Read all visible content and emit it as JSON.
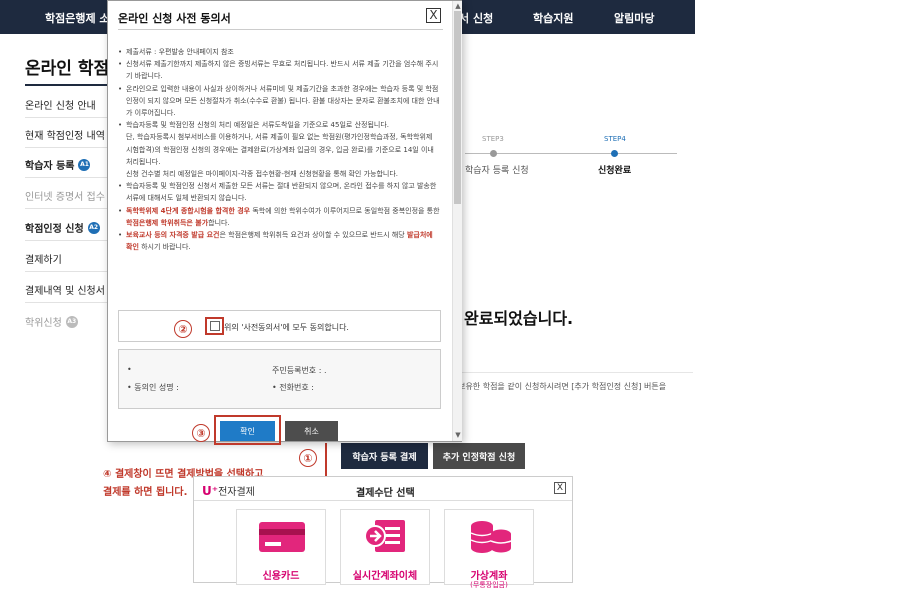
{
  "topnav": {
    "items": [
      "학점은행제 소",
      "서 신청",
      "학습지원",
      "알림마당"
    ]
  },
  "page": {
    "title": "온라인 학점인"
  },
  "sidebar": {
    "items": [
      {
        "label": "온라인 신청 안내",
        "badge": ""
      },
      {
        "label": "현재 학점인정 내역",
        "badge": ""
      },
      {
        "label": "학습자 등록",
        "badge": "A1"
      },
      {
        "label": "인터넷 증명서 접수",
        "badge": ""
      },
      {
        "label": "학점인정 신청",
        "badge": "A2"
      },
      {
        "label": "결제하기",
        "badge": ""
      },
      {
        "label": "결제내역 및 신청서 출",
        "badge": ""
      },
      {
        "label": "학위신청",
        "badge": "A3"
      }
    ]
  },
  "steps": [
    {
      "label": "STEP3",
      "name": "학습자 등록 신청"
    },
    {
      "label": "STEP4",
      "name": "신청완료"
    }
  ],
  "main": {
    "complete_message": "완료되었습니다.",
    "info_line": ", 보유한 학점을 같이 신청하시려면 [추가 학점인정 신청] 버튼을",
    "register_button": "학습자 등록 결제",
    "add_button": "추가 인정학점 신청"
  },
  "annotations": {
    "num1": "①",
    "num2": "②",
    "num3": "③",
    "step4_line1": "④ 결제창이 뜨면 결제방법을 선택하고",
    "step4_line2": "결제를 하면 됩니다."
  },
  "payment": {
    "logo_mark": "U⁺",
    "logo_text": "전자결제",
    "title": "결제수단 선택",
    "close": "X",
    "options": [
      {
        "label": "신용카드",
        "sub": ""
      },
      {
        "label": "실시간계좌이체",
        "sub": ""
      },
      {
        "label": "가상계좌",
        "sub": "(무통장입금)"
      }
    ]
  },
  "modal": {
    "title": "온라인 신청 사전 동의서",
    "close": "X",
    "terms": [
      {
        "type": "bullet",
        "text": "제출서류 : 우편발송 안내페이지 참조"
      },
      {
        "type": "bullet",
        "text": "신청서류 제출기한까지 제출하지 않은 증빙서류는 무효로 처리됩니다. 반드시 서류 제출 기간을 엄수해 주시기 바랍니다."
      },
      {
        "type": "bullet",
        "text": "온라인으로 입력한 내용이 사실과 상이하거나 서류미비 및 제출기간을 초과한 경우에는 학습자 등록 및 학점인정이 되지 않으며 모든 신청절차가 취소(수수료 환불) 됩니다. 환불 대상자는 문자로 환불조치에 대한 안내가 이루어집니다."
      },
      {
        "type": "bullet",
        "text": "학습자등록 및 학점인정 신청의 처리 예정일은 서류도착일을 기준으로 45일로 산정됩니다."
      },
      {
        "type": "indent",
        "text": "단, 학습자등록시 첨부서비스를 이용하거나, 서류 제출이 필요 없는 학점원(평가인정학습과정, 독학학위제 시험합격)의 학점인정 신청의 경우에는 결제완료(가상계좌 입금의 경우, 입금 완료)를 기준으로 14일 이내 처리됩니다."
      },
      {
        "type": "indent",
        "text": "신청 건수별 처리 예정일은 마이페이지-각종 접수현황-현재 신청현황을 통해 확인 가능합니다."
      },
      {
        "type": "bullet",
        "text": "학습자등록 및 학점인정 신청서 제출한 모든 서류는 절대 반환되지 않으며, 온라인 접수를 하지 않고 발송한 서류에 대해서도 일체 반환되지 않습니다."
      },
      {
        "type": "bullet-red",
        "hl1": "독학학위제 4단계 종합시험을 합격한 경우",
        "text": " 독학에 의한 학위수여가 이루어지므로 동일학점 중복인정을 통한 ",
        "hl2": "학점은행제 학위취득은 불가",
        "tail": "합니다."
      },
      {
        "type": "bullet-red2",
        "hl1": "보육교사 등의 자격증 발급 요건",
        "text": "은 학점은행제 학위취득 요건과 상이할 수 있으므로 반드시 해당 ",
        "hl2": "발급처에 확인",
        "tail": " 하시기 바랍니다."
      }
    ],
    "agree_label": "위의 '사전동의서'에 모두 동의합니다.",
    "person": {
      "row1_right": "주민등록번호 : .",
      "row2_left": "동의인 성명 :",
      "row2_right": "전화번호 :"
    },
    "confirm_label": "확인",
    "cancel_label": "취소"
  },
  "colors": {
    "nav_bg": "#1e2a3f",
    "accent_blue": "#1f7bc7",
    "annotation_red": "#c0392b",
    "uplus_pink": "#d6006f"
  }
}
